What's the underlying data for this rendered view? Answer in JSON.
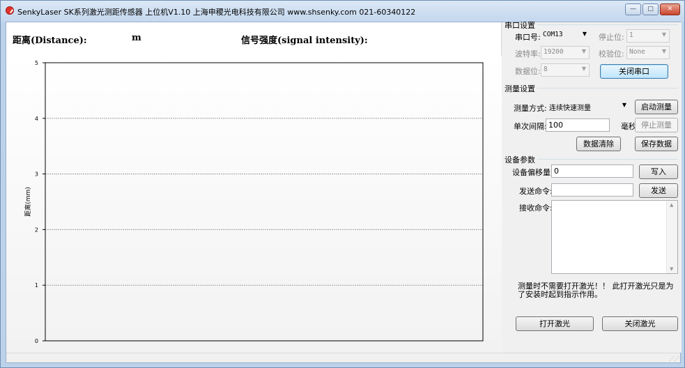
{
  "window": {
    "title": "SenkyLaser SK系列激光测距传感器 上位机V1.10 上海申稷光电科技有限公司 www.shsenky.com  021-60340122",
    "minimize_glyph": "—",
    "maximize_glyph": "□",
    "close_glyph": "✕"
  },
  "readout": {
    "distance_label": "距离(Distance):",
    "distance_unit": "m",
    "signal_label": "信号强度(signal intensity):"
  },
  "chart_data": {
    "type": "line",
    "ylabel": "距离(mm)",
    "xlabel": "",
    "ylim": [
      0,
      5
    ],
    "yticks": [
      "0",
      "1",
      "2",
      "3",
      "4",
      "5"
    ],
    "grid": true,
    "series": []
  },
  "serial": {
    "group_title": "串口设置",
    "port_label": "串口号:",
    "port_value": "COM13",
    "stopbit_label": "停止位:",
    "stopbit_value": "1",
    "baud_label": "波特率:",
    "baud_value": "19200",
    "parity_label": "校验位:",
    "parity_value": "None",
    "databits_label": "数据位:",
    "databits_value": "8",
    "close_port_button": "关闭串口"
  },
  "measure": {
    "group_title": "测量设置",
    "mode_label": "测量方式:",
    "mode_value": "连续快速测量",
    "start_button": "启动测量",
    "interval_label": "单次间隔:",
    "interval_value": "100",
    "interval_unit": "毫秒",
    "stop_button": "停止测量",
    "clear_button": "数据清除",
    "save_button": "保存数据"
  },
  "device": {
    "group_title": "设备参数",
    "offset_label": "设备偏移量:",
    "offset_value": "0",
    "write_button": "写入",
    "send_label": "发送命令:",
    "send_value": "",
    "send_button": "发送",
    "recv_label": "接收命令:",
    "recv_value": "",
    "note": "测量时不需要打开激光！！ 此打开激光只是为了安装时起到指示作用。",
    "laser_on_button": "打开激光",
    "laser_off_button": "关闭激光",
    "scroll_up_glyph": "▲",
    "scroll_down_glyph": "▼"
  },
  "colors": {
    "title_bar": "#c4d7ee",
    "chart_border": "#000000",
    "grid_line": "#a0a0a0",
    "close_button": "#c9442d"
  }
}
